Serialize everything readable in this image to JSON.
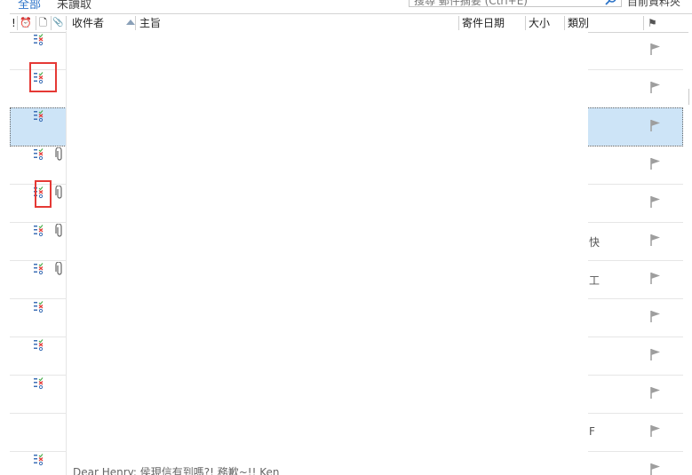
{
  "filter": {
    "all": "全部",
    "unread": "未讀取",
    "search_placeholder": "搜尋 郵件摘要 (Ctrl+E)",
    "mailbox": "目前資料夾"
  },
  "header": {
    "importance": "!",
    "reminder": "⏰",
    "type": "🗋",
    "attachment": "📎",
    "recipient": "收件者",
    "subject": "主旨",
    "date": "寄件日期",
    "size": "大小",
    "category": "類別",
    "flag": "⚑"
  },
  "rows": [
    {
      "icon": true,
      "clip": false,
      "cat": "",
      "selected": false
    },
    {
      "icon": true,
      "clip": false,
      "cat": "",
      "selected": false
    },
    {
      "icon": true,
      "clip": false,
      "cat": "",
      "selected": true
    },
    {
      "icon": true,
      "clip": true,
      "cat": "",
      "selected": false
    },
    {
      "icon": true,
      "clip": true,
      "cat": "",
      "selected": false
    },
    {
      "icon": true,
      "clip": true,
      "cat": "快",
      "selected": false
    },
    {
      "icon": true,
      "clip": true,
      "cat": "工",
      "selected": false
    },
    {
      "icon": true,
      "clip": false,
      "cat": "",
      "selected": false
    },
    {
      "icon": true,
      "clip": false,
      "cat": "",
      "selected": false
    },
    {
      "icon": true,
      "clip": false,
      "cat": "",
      "selected": false
    },
    {
      "icon": false,
      "clip": false,
      "cat": "F",
      "selected": false
    },
    {
      "icon": true,
      "clip": false,
      "cat": "",
      "selected": false
    }
  ],
  "preview_text": "Dear Henry: 侯現信有到嗎?! 務歉~!! Ken",
  "colors": {
    "accent": "#2b73c8",
    "selected_row": "#cde4f7",
    "highlight_box": "#e53935",
    "flag": "#9e9e9e"
  }
}
